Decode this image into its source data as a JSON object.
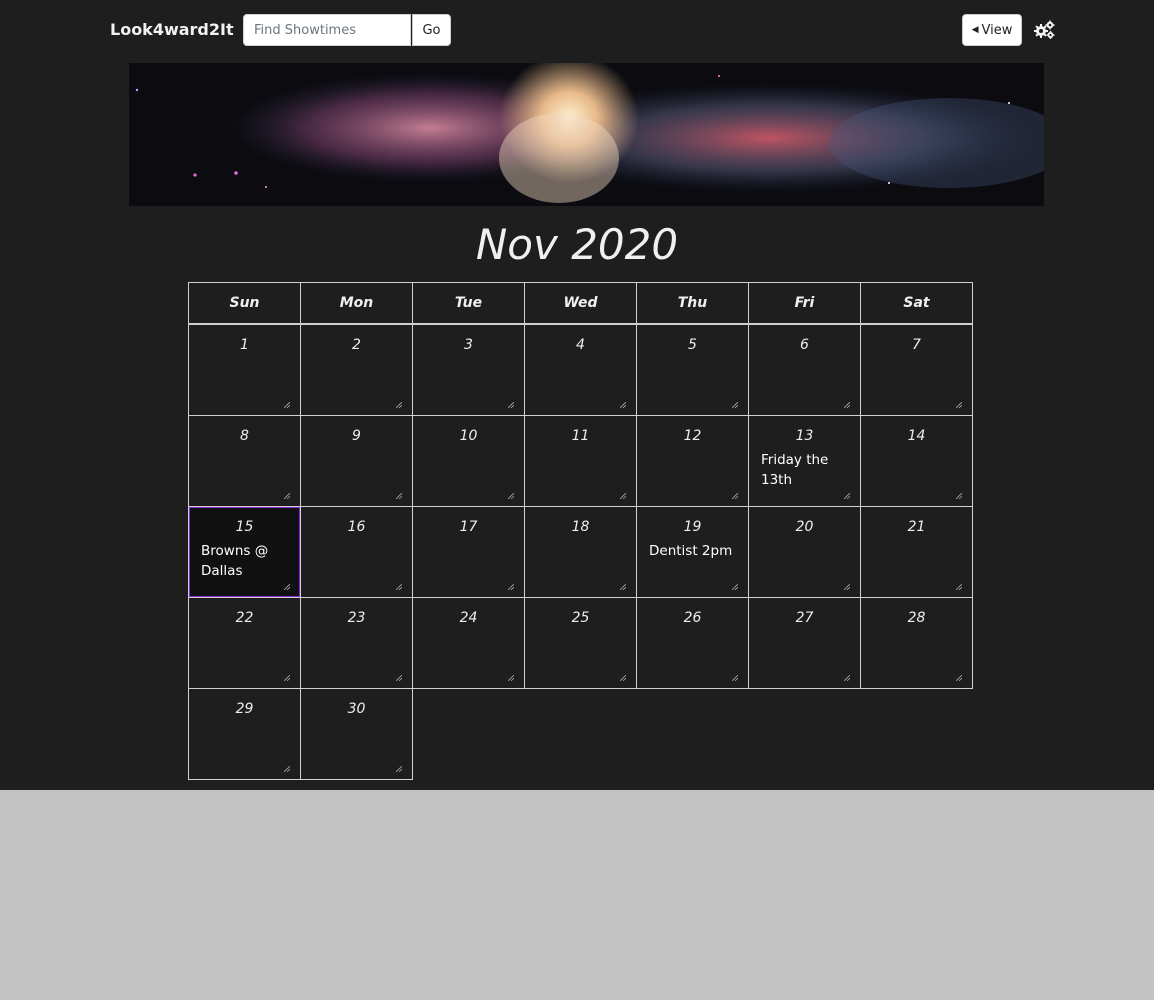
{
  "nav": {
    "brand": "Look4ward2It",
    "search_placeholder": "Find Showtimes",
    "go_label": "Go",
    "view_label": "View",
    "settings_icon": "gears-icon"
  },
  "calendar": {
    "title": "Nov 2020",
    "weekdays": [
      "Sun",
      "Mon",
      "Tue",
      "Wed",
      "Thu",
      "Fri",
      "Sat"
    ],
    "weeks": [
      [
        {
          "d": "1",
          "n": ""
        },
        {
          "d": "2",
          "n": ""
        },
        {
          "d": "3",
          "n": ""
        },
        {
          "d": "4",
          "n": ""
        },
        {
          "d": "5",
          "n": ""
        },
        {
          "d": "6",
          "n": ""
        },
        {
          "d": "7",
          "n": ""
        }
      ],
      [
        {
          "d": "8",
          "n": ""
        },
        {
          "d": "9",
          "n": ""
        },
        {
          "d": "10",
          "n": ""
        },
        {
          "d": "11",
          "n": ""
        },
        {
          "d": "12",
          "n": ""
        },
        {
          "d": "13",
          "n": "Friday the 13th"
        },
        {
          "d": "14",
          "n": ""
        }
      ],
      [
        {
          "d": "15",
          "n": "Browns @ Dallas",
          "today": true
        },
        {
          "d": "16",
          "n": ""
        },
        {
          "d": "17",
          "n": ""
        },
        {
          "d": "18",
          "n": ""
        },
        {
          "d": "19",
          "n": "Dentist 2pm"
        },
        {
          "d": "20",
          "n": ""
        },
        {
          "d": "21",
          "n": ""
        }
      ],
      [
        {
          "d": "22",
          "n": ""
        },
        {
          "d": "23",
          "n": ""
        },
        {
          "d": "24",
          "n": ""
        },
        {
          "d": "25",
          "n": ""
        },
        {
          "d": "26",
          "n": ""
        },
        {
          "d": "27",
          "n": ""
        },
        {
          "d": "28",
          "n": ""
        }
      ],
      [
        {
          "d": "29",
          "n": ""
        },
        {
          "d": "30",
          "n": ""
        }
      ]
    ]
  },
  "colors": {
    "background": "#1e1e1e",
    "page": "#c3c3c3",
    "today_glow_a": "#00c8ff",
    "today_glow_b": "#c800ff"
  }
}
